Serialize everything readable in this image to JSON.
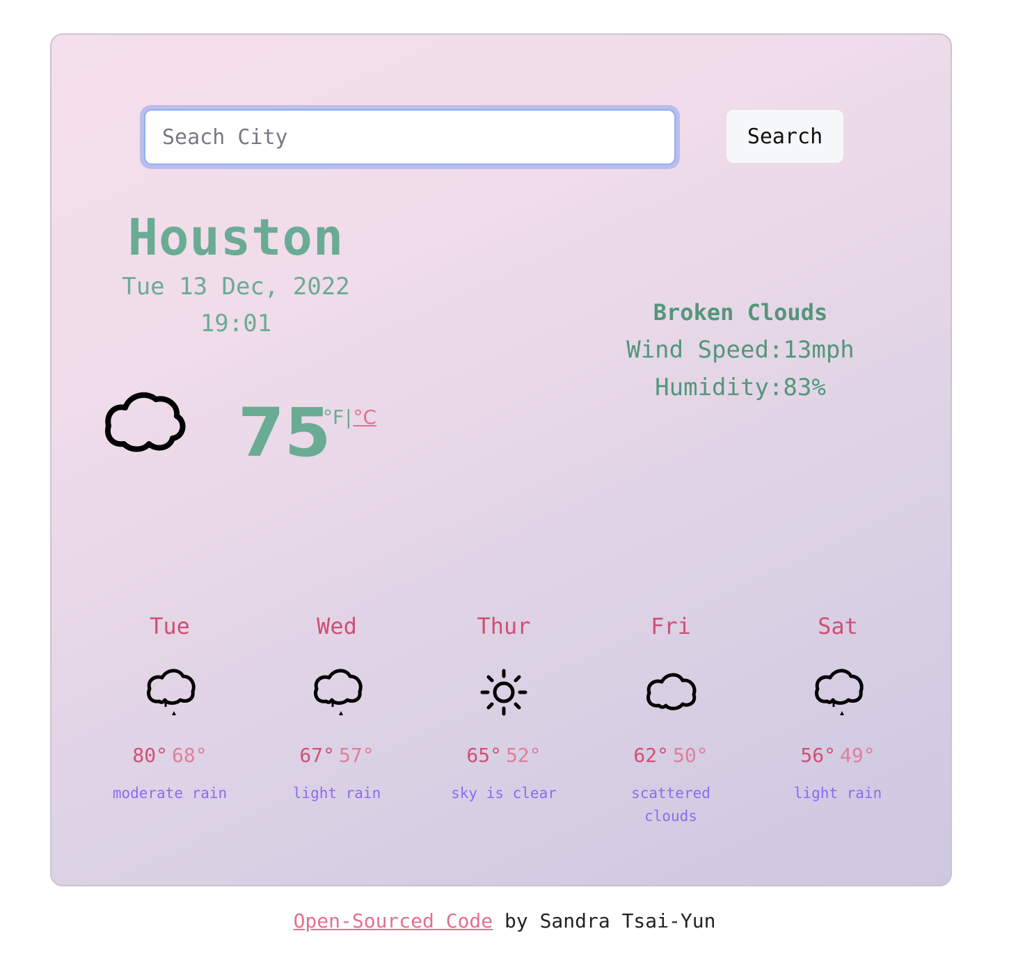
{
  "search": {
    "placeholder": "Seach City",
    "value": "",
    "button_label": "Search"
  },
  "current": {
    "city": "Houston",
    "date": "Tue 13 Dec, 2022",
    "time": "19:01",
    "icon": "cloud-icon",
    "temperature": "75",
    "unit_fahrenheit": "°F",
    "unit_separator": "|",
    "unit_celsius": "°C",
    "description": "Broken Clouds",
    "wind_label": "Wind Speed:",
    "wind_value": "13mph",
    "humidity_label": "Humidity:",
    "humidity_value": "83%"
  },
  "forecast": [
    {
      "day": "Tue",
      "icon": "rain-cloud-icon",
      "high": "80°",
      "low": "68°",
      "description": "moderate rain"
    },
    {
      "day": "Wed",
      "icon": "rain-cloud-icon",
      "high": "67°",
      "low": "57°",
      "description": "light rain"
    },
    {
      "day": "Thur",
      "icon": "sun-icon",
      "high": "65°",
      "low": "52°",
      "description": "sky is clear"
    },
    {
      "day": "Fri",
      "icon": "cloud-icon",
      "high": "62°",
      "low": "50°",
      "description": "scattered clouds"
    },
    {
      "day": "Sat",
      "icon": "rain-cloud-icon",
      "high": "56°",
      "low": "49°",
      "description": "light rain"
    }
  ],
  "footer": {
    "link_label": "Open-Sourced Code",
    "credit": " by Sandra Tsai-Yun"
  },
  "colors": {
    "primary_green": "#6aab94",
    "detail_green": "#539679",
    "accent_pink": "#d04f74",
    "link_pink": "#e2708f",
    "description_purple": "#8c6bef",
    "gradient_start": "#f5dfec",
    "gradient_end": "#cdc7e0"
  }
}
